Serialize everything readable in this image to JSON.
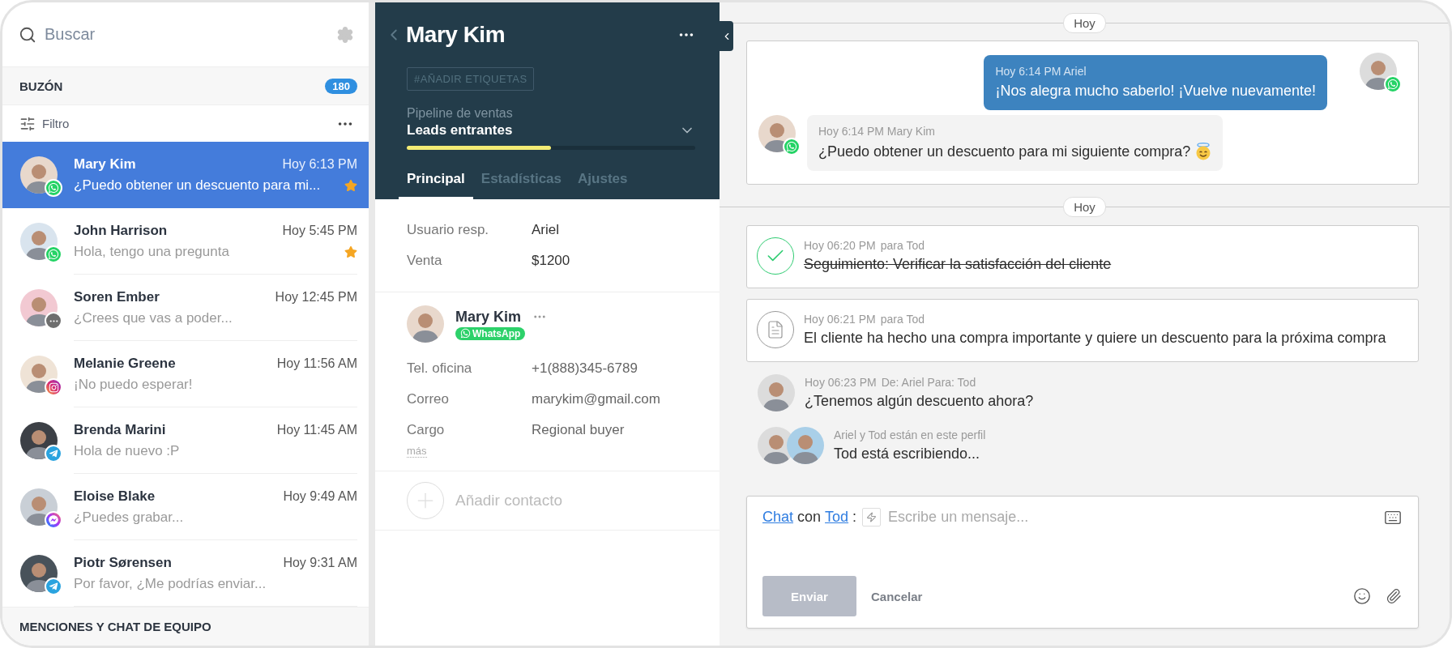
{
  "sidebar": {
    "search": {
      "placeholder": "Buscar"
    },
    "inbox": {
      "title": "BUZÓN",
      "count": "180"
    },
    "filter": {
      "label": "Filtro"
    },
    "conversations": [
      {
        "name": "Mary Kim",
        "time": "Hoy 6:13 PM",
        "preview": "¿Puedo obtener un descuento para mi...",
        "starred": true,
        "kind": "whatsapp",
        "selected": true
      },
      {
        "name": "John Harrison",
        "time": "Hoy 5:45 PM",
        "preview": "Hola, tengo una pregunta",
        "starred": true,
        "kind": "whatsapp",
        "selected": false
      },
      {
        "name": "Soren Ember",
        "time": "Hoy 12:45 PM",
        "preview": "¿Crees que vas a poder...",
        "starred": false,
        "kind": "chat",
        "selected": false
      },
      {
        "name": "Melanie Greene",
        "time": "Hoy 11:56 AM",
        "preview": "¡No puedo esperar!",
        "starred": false,
        "kind": "instagram",
        "selected": false
      },
      {
        "name": "Brenda Marini",
        "time": "Hoy 11:45 AM",
        "preview": "Hola de nuevo :P",
        "starred": false,
        "kind": "telegram",
        "selected": false
      },
      {
        "name": "Eloise Blake",
        "time": "Hoy 9:49 AM",
        "preview": "¿Puedes grabar...",
        "starred": false,
        "kind": "messenger",
        "selected": false
      },
      {
        "name": "Piotr Sørensen",
        "time": "Hoy 9:31 AM",
        "preview": "Por favor, ¿Me podrías enviar...",
        "starred": false,
        "kind": "telegram",
        "selected": false
      }
    ],
    "footer": "MENCIONES Y CHAT DE EQUIPO"
  },
  "profile": {
    "title": "Mary Kim",
    "tag_button": "#AÑADIR ETIQUETAS",
    "pipeline": {
      "label": "Pipeline de ventas",
      "value": "Leads entrantes",
      "level": 0.5
    },
    "tabs": [
      {
        "label": "Principal",
        "selected": true
      },
      {
        "label": "Estadísticas",
        "selected": false
      },
      {
        "label": "Ajustes",
        "selected": false
      }
    ],
    "fields": [
      {
        "label": "Usuario resp.",
        "value": "Ariel"
      },
      {
        "label": "Venta",
        "value": "$1200"
      }
    ],
    "contact": {
      "name": "Mary Kim",
      "channel_label": "WhatsApp",
      "fields": [
        {
          "label": "Tel. oficina",
          "value": "+1(888)345-6789"
        },
        {
          "label": "Correo",
          "value": "marykim@gmail.com"
        },
        {
          "label": "Cargo",
          "value": "Regional buyer"
        }
      ],
      "more": "más"
    },
    "add_contact": "Añadir contacto"
  },
  "feed": {
    "date_1": "Hoy",
    "chat": [
      {
        "kind": "outgoing",
        "time": "Hoy 6:14 PM",
        "author": "Ariel",
        "text": "¡Nos alegra mucho saberlo! ¡Vuelve nuevamente!"
      },
      {
        "kind": "incoming",
        "time": "Hoy 6:14 PM",
        "author": "Mary Kim",
        "text": "¿Puedo obtener un descuento para mi siguiente compra?"
      }
    ],
    "date_2": "Hoy",
    "events": [
      {
        "kind": "task",
        "time": "Hoy 06:20 PM",
        "target": "para Tod",
        "text": "Seguimiento: Verificar la satisfacción del cliente",
        "done": true
      },
      {
        "kind": "note",
        "time": "Hoy 06:21 PM",
        "target": "para Tod",
        "text": "El cliente ha hecho una compra importante y quiere un descuento para la próxima compra"
      }
    ],
    "internal": {
      "time": "Hoy 06:23 PM",
      "meta": "De: Ariel Para: Tod",
      "text": "¿Tenemos algún descuento ahora?"
    },
    "typing": {
      "meta": "Ariel y Tod están en este perfil",
      "text": "Tod está escribiendo..."
    },
    "composer": {
      "channel_link": "Chat",
      "joiner": "con",
      "recipient_link": "Tod",
      "colon": ":",
      "placeholder": "Escribe un mensaje...",
      "send": "Enviar",
      "send_disabled": true,
      "cancel": "Cancelar"
    }
  }
}
